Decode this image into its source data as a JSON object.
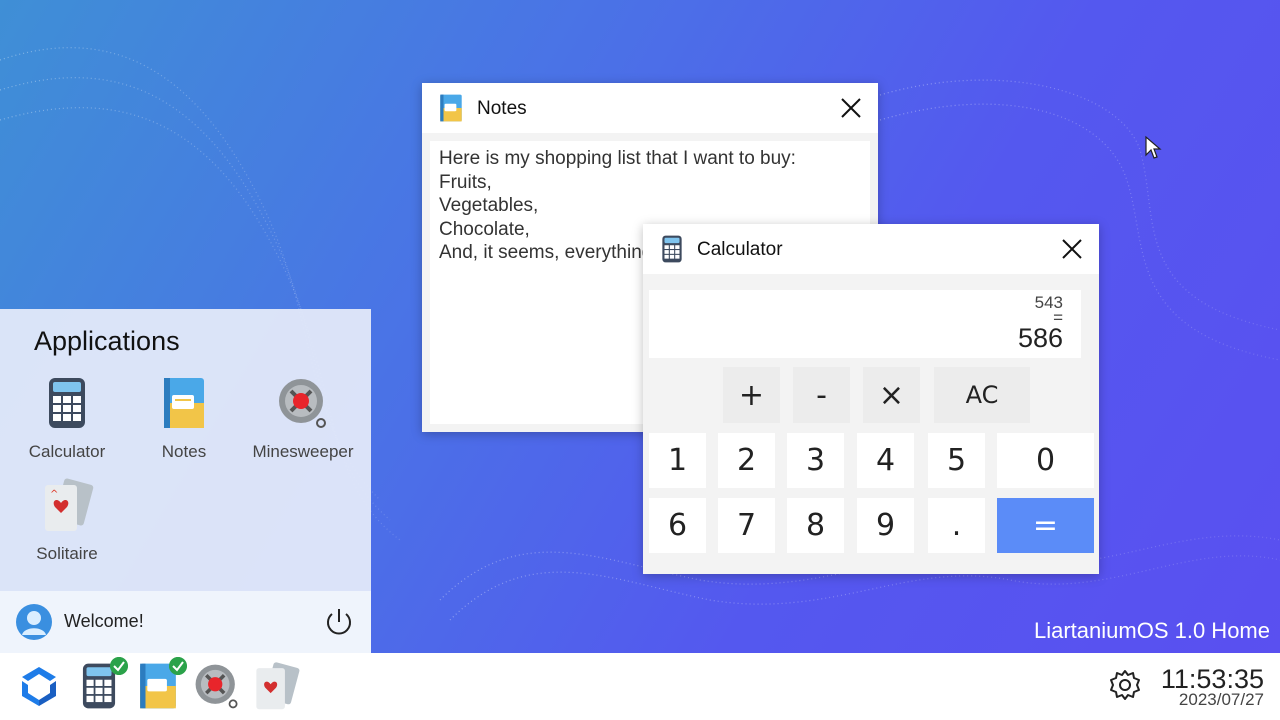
{
  "colors": {
    "accent": "#5b8cf8",
    "check": "#2ba24a",
    "background_start": "#3f8fd6",
    "background_end": "#5a4ff0"
  },
  "start_menu": {
    "title": "Applications",
    "apps": [
      {
        "label": "Calculator",
        "icon": "calculator-icon"
      },
      {
        "label": "Notes",
        "icon": "notes-icon"
      },
      {
        "label": "Minesweeper",
        "icon": "mine-icon"
      },
      {
        "label": "Solitaire",
        "icon": "cards-icon"
      }
    ],
    "welcome": "Welcome!",
    "power_icon": "power-icon",
    "avatar_icon": "user-avatar-icon"
  },
  "notes_window": {
    "title": "Notes",
    "icon": "notes-icon",
    "lines": [
      "Here is my shopping list that I want to buy:",
      "Fruits,",
      "Vegetables,",
      "Chocolate,",
      "And, it seems, everything"
    ]
  },
  "calculator_window": {
    "title": "Calculator",
    "icon": "calculator-icon",
    "previous": "543",
    "equals_sign": "=",
    "result": "586",
    "operators": [
      "+",
      "-",
      "×",
      "AC"
    ],
    "row1": [
      "1",
      "2",
      "3",
      "4",
      "5",
      "0"
    ],
    "row2": [
      "6",
      "7",
      "8",
      "9",
      "."
    ],
    "equals_button": "="
  },
  "os_label": "LiartaniumOS 1.0 Home",
  "taskbar": {
    "start_icon": "os-logo-icon",
    "items": [
      {
        "icon": "calculator-icon",
        "running": true
      },
      {
        "icon": "notes-icon",
        "running": true
      },
      {
        "icon": "mine-icon",
        "running": false
      },
      {
        "icon": "cards-icon",
        "running": false
      }
    ],
    "settings_icon": "gear-icon",
    "time": "11:53:35",
    "date": "2023/07/27"
  }
}
